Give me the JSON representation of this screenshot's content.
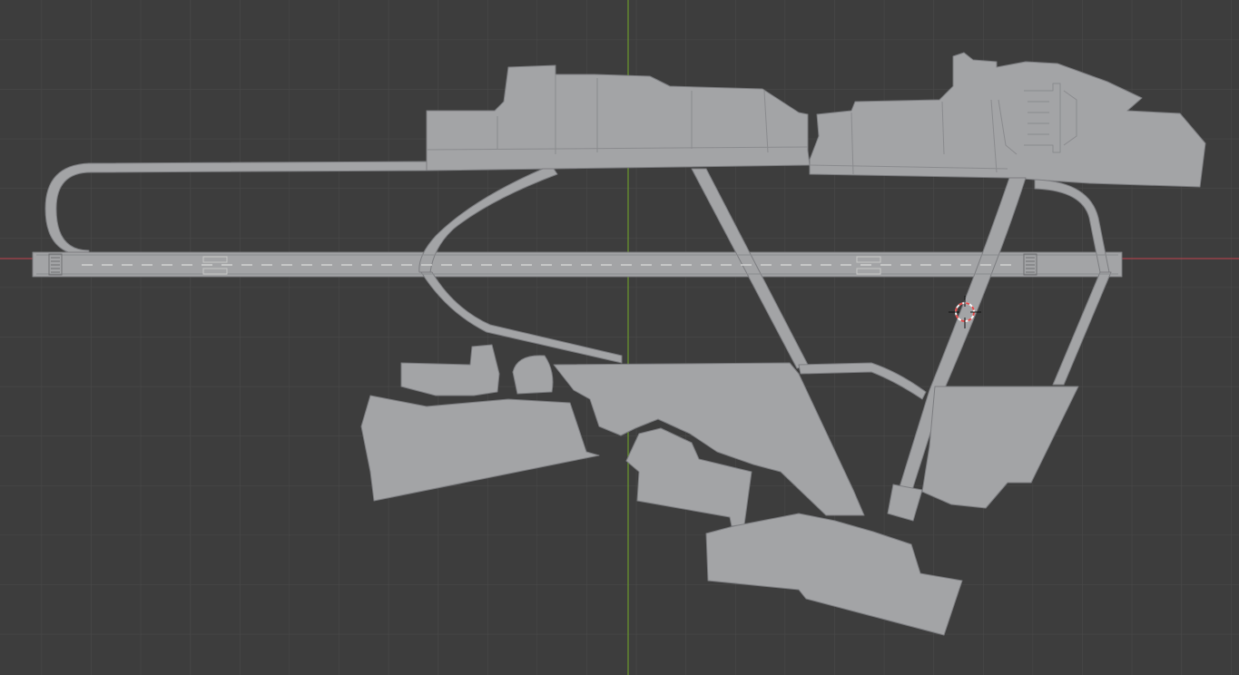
{
  "viewport": {
    "mode": "top-orthographic",
    "grid_visible": true,
    "background_color": "#3d3d3d",
    "grid_color": "#4b4b4b",
    "x_axis_color": "#a8434b",
    "y_axis_color": "#6a9a2c"
  },
  "scene": {
    "object": "airport-layout-mesh",
    "surface_color": "#a3a4a6",
    "edge_color": "#7c7d80",
    "runway_marking_color": "#d3d3d3"
  },
  "cursor": {
    "icon": "3d-cursor-icon",
    "ring_colors": [
      "#e24a4a",
      "#f4f4f4"
    ]
  }
}
